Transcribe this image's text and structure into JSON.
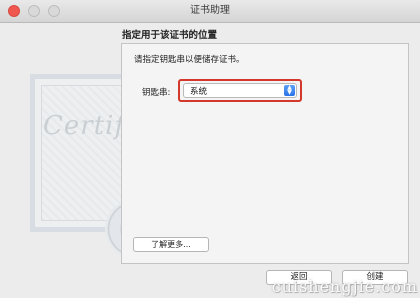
{
  "window": {
    "title": "证书助理"
  },
  "content": {
    "heading": "指定用于该证书的位置",
    "instruction": "请指定钥匙串以便储存证书。",
    "keychain_label": "钥匙串:",
    "keychain_value": "系统",
    "learn_more_label": "了解更多..."
  },
  "buttons": {
    "back_label": "返回",
    "create_label": "创建"
  },
  "artwork": {
    "certificate_text": "Certificate"
  },
  "watermark": "cuishengjie.com",
  "colors": {
    "highlight": "#d2382b",
    "select_arrow": "#2a73e8",
    "close": "#f0584f"
  }
}
